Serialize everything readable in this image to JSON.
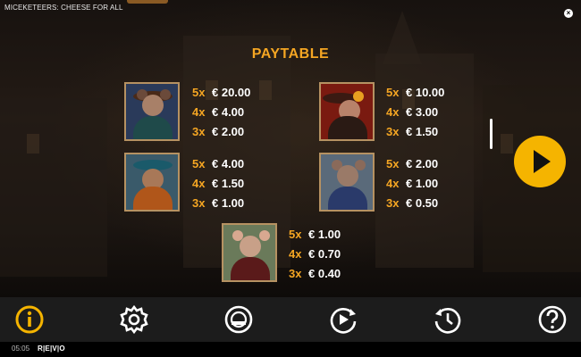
{
  "window": {
    "title": "MICEKETEERS: CHEESE FOR ALL",
    "close_label": "×"
  },
  "paytable": {
    "title": "PAYTABLE",
    "symbols": [
      {
        "name": "lady-mouse",
        "pays": [
          {
            "mult": "5x",
            "amount": "€ 20.00"
          },
          {
            "mult": "4x",
            "amount": "€ 4.00"
          },
          {
            "mult": "3x",
            "amount": "€ 2.00"
          }
        ]
      },
      {
        "name": "hat-mouse",
        "pays": [
          {
            "mult": "5x",
            "amount": "€ 10.00"
          },
          {
            "mult": "4x",
            "amount": "€ 3.00"
          },
          {
            "mult": "3x",
            "amount": "€ 1.50"
          }
        ]
      },
      {
        "name": "musketeer-mouse",
        "pays": [
          {
            "mult": "5x",
            "amount": "€ 4.00"
          },
          {
            "mult": "4x",
            "amount": "€ 1.50"
          },
          {
            "mult": "3x",
            "amount": "€ 1.00"
          }
        ]
      },
      {
        "name": "caped-mouse",
        "pays": [
          {
            "mult": "5x",
            "amount": "€ 2.00"
          },
          {
            "mult": "4x",
            "amount": "€ 1.00"
          },
          {
            "mult": "3x",
            "amount": "€ 0.50"
          }
        ]
      },
      {
        "name": "noble-mouse",
        "pays": [
          {
            "mult": "5x",
            "amount": "€ 1.00"
          },
          {
            "mult": "4x",
            "amount": "€ 0.70"
          },
          {
            "mult": "3x",
            "amount": "€ 0.40"
          }
        ]
      }
    ]
  },
  "toolbar": {
    "items": [
      {
        "icon": "info-icon",
        "active": true
      },
      {
        "icon": "settings-gear-icon",
        "active": false
      },
      {
        "icon": "game-rules-icon",
        "active": false
      },
      {
        "icon": "autoplay-icon",
        "active": false
      },
      {
        "icon": "history-icon",
        "active": false
      },
      {
        "icon": "help-icon",
        "active": false
      }
    ]
  },
  "status": {
    "time": "05:05",
    "brand": "R|E|V|O"
  },
  "colors": {
    "accent": "#f5a623",
    "play": "#f5b400",
    "toolbar": "#1c1c1c"
  }
}
